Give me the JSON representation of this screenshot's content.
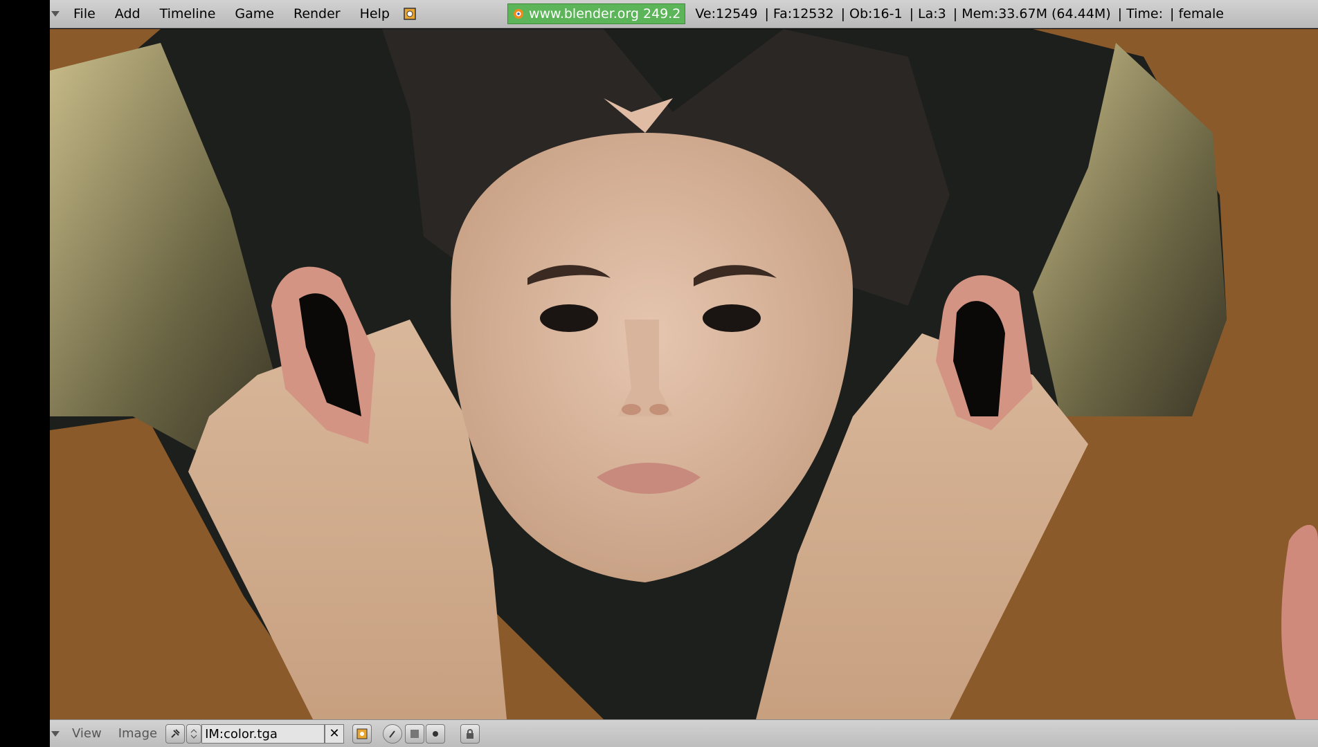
{
  "top_bar": {
    "menu": [
      "File",
      "Add",
      "Timeline",
      "Game",
      "Render",
      "Help"
    ],
    "url_badge": "www.blender.org 249.2",
    "stats": {
      "ve": "Ve:12549",
      "fa": "Fa:12532",
      "ob": "Ob:16-1",
      "la": "La:3",
      "mem": "Mem:33.67M (64.44M)",
      "time": "Time:",
      "scene": "female"
    }
  },
  "bottom_bar": {
    "view_label": "View",
    "image_label": "Image",
    "image_name": "IM:color.tga"
  },
  "colors": {
    "viewport_bg": "#8a5a2b",
    "badge_green": "#5db55a"
  }
}
